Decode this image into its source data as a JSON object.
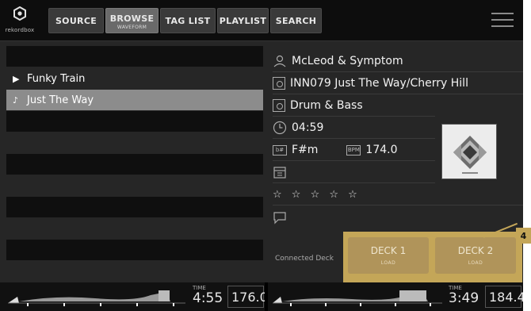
{
  "brand": {
    "logo_text": "rekordbox"
  },
  "tabs": [
    {
      "label": "SOURCE"
    },
    {
      "label": "BROWSE",
      "sub": "WAVEFORM"
    },
    {
      "label": "TAG LIST"
    },
    {
      "label": "PLAYLIST"
    },
    {
      "label": "SEARCH"
    }
  ],
  "tracks": [
    {
      "glyph": "▶",
      "title": "Funky Train"
    },
    {
      "glyph": "♪",
      "title": "Just The Way"
    }
  ],
  "track_info": {
    "artist": "McLeod & Symptom",
    "album": "INN079 Just The Way/Cherry Hill",
    "genre": "Drum & Bass",
    "duration": "04:59",
    "key_icon": "b#",
    "key": "F#m",
    "bpm_icon": "BPM",
    "bpm": "174.0",
    "rating": "☆ ☆ ☆ ☆ ☆"
  },
  "decks": {
    "connected_label": "Connected Deck",
    "deck1": {
      "label": "DECK 1",
      "sub": "LOAD"
    },
    "deck2": {
      "label": "DECK 2",
      "sub": "LOAD"
    },
    "callout": "4"
  },
  "status": {
    "left": {
      "time_label": "TIME",
      "time": "4:55",
      "bpm": "176.0"
    },
    "right": {
      "time_label": "TIME",
      "time": "3:49",
      "bpm": "184.4"
    }
  },
  "colors": {
    "accent_gold": "#c4a658",
    "selected_row": "#8c8c8c"
  }
}
